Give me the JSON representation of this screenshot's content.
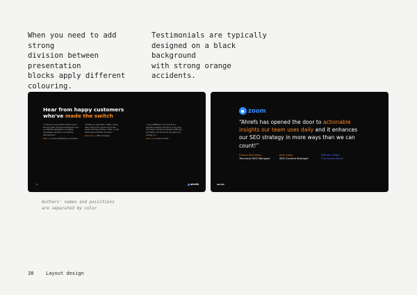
{
  "paragraphs": {
    "left": "When you need to add strong\ndivision between presentation\nblocks apply different colouring.",
    "right": "Testimonials are typically\ndesigned on a black background\nwith strong orange accidents."
  },
  "slide_left": {
    "title_line1": "Hear from happy customers",
    "title_line2_a": "who've ",
    "title_line2_b": "made the switch",
    "columns": [
      {
        "quote": "\"In the end, we picked Ahrefs due to the big need of keyword research and a complete database in multiple languages. Ahrefs is our all-time favorite tool.\"",
        "author_name": "Mike S.",
        "author_role": "| Online Marketing consultant"
      },
      {
        "quote": "\"Ahrefs is a standard in SEO. I have been using it for years and it has saved me many times. I wish I could have learned about it sooner.\"",
        "author_name": "Ramona C.",
        "author_role": "| SEO manager"
      },
      {
        "quote": "\"I love SEMRush, but I found for keyword research Ahrefs is a lot more accurate in terms of keyword difficulty and what I should focus my time and energy on.\"",
        "author_name": "Dave H.",
        "author_role": "| Content writer"
      }
    ],
    "page_number": "38",
    "logo_text": "ahrefs"
  },
  "slide_right": {
    "brand": "zoom",
    "quote_open": "“Ahrefs has opened the door to ",
    "quote_highlight": "actionable insights our team uses daily",
    "quote_close": " and it enhances our SEO strategy in more ways than we can count!”",
    "authors": [
      {
        "name": "Franco Buchman,",
        "role": "Technical SEO Manager"
      },
      {
        "name": "Jenn Lang,",
        "role": "SEO Content Manager"
      },
      {
        "name": "@Zoom Video Communications",
        "role": ""
      }
    ],
    "logo_text": "ahrefs"
  },
  "caption": "Authors' names and poisitions\nare separated by color",
  "footer": {
    "page": "38",
    "section": "Layout design"
  },
  "colors": {
    "accent_orange": "#ff8a1f",
    "accent_blue": "#4b6bff",
    "zoom_blue": "#2d8cff",
    "slide_bg": "#0b0b0c"
  }
}
